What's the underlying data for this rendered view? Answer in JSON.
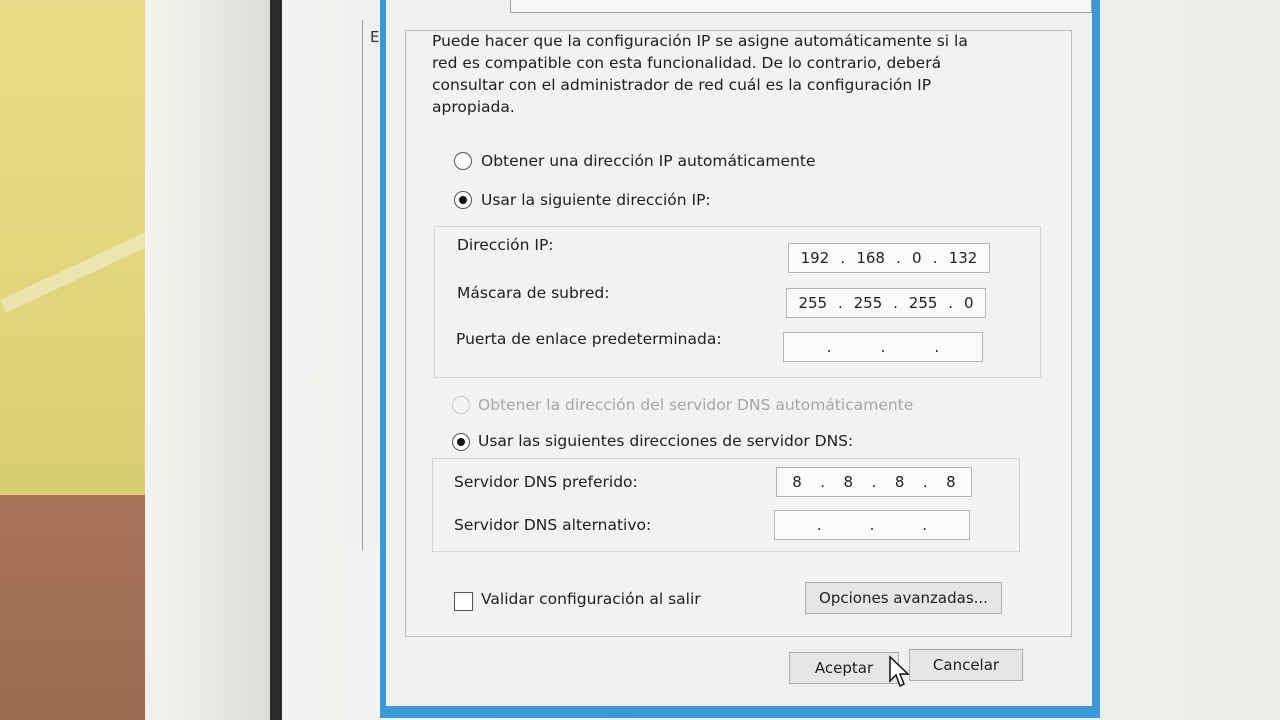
{
  "parent_window": {
    "title_char": "E"
  },
  "dialog": {
    "description": [
      "Puede hacer que la configuración IP se asigne automáticamente si la",
      "red es compatible con esta funcionalidad. De lo contrario, deberá",
      "consultar con el administrador de red cuál es la configuración IP",
      "apropiada."
    ],
    "ip_mode": {
      "auto_label": "Obtener una dirección IP automáticamente",
      "manual_label": "Usar la siguiente dirección IP:",
      "selected": "manual"
    },
    "ip_fields": {
      "ip_label": "Dirección IP:",
      "ip_octets": [
        "192",
        "168",
        "0",
        "132"
      ],
      "mask_label": "Máscara de subred:",
      "mask_octets": [
        "255",
        "255",
        "255",
        "0"
      ],
      "gateway_label": "Puerta de enlace predeterminada:",
      "gateway_octets": [
        "",
        "",
        "",
        ""
      ]
    },
    "dns_mode": {
      "auto_label": "Obtener la dirección del servidor DNS automáticamente",
      "manual_label": "Usar las siguientes direcciones de servidor DNS:",
      "selected": "manual"
    },
    "dns_fields": {
      "preferred_label": "Servidor DNS preferido:",
      "preferred_octets": [
        "8",
        "8",
        "8",
        "8"
      ],
      "alternate_label": "Servidor DNS alternativo:",
      "alternate_octets": [
        "",
        "",
        "",
        ""
      ]
    },
    "validate_label": "Validar configuración al salir",
    "validate_checked": false,
    "advanced_button": "Opciones avanzadas...",
    "ok_button": "Aceptar",
    "cancel_button": "Cancelar"
  },
  "colors": {
    "dialog_border": "#3a9ad8"
  }
}
